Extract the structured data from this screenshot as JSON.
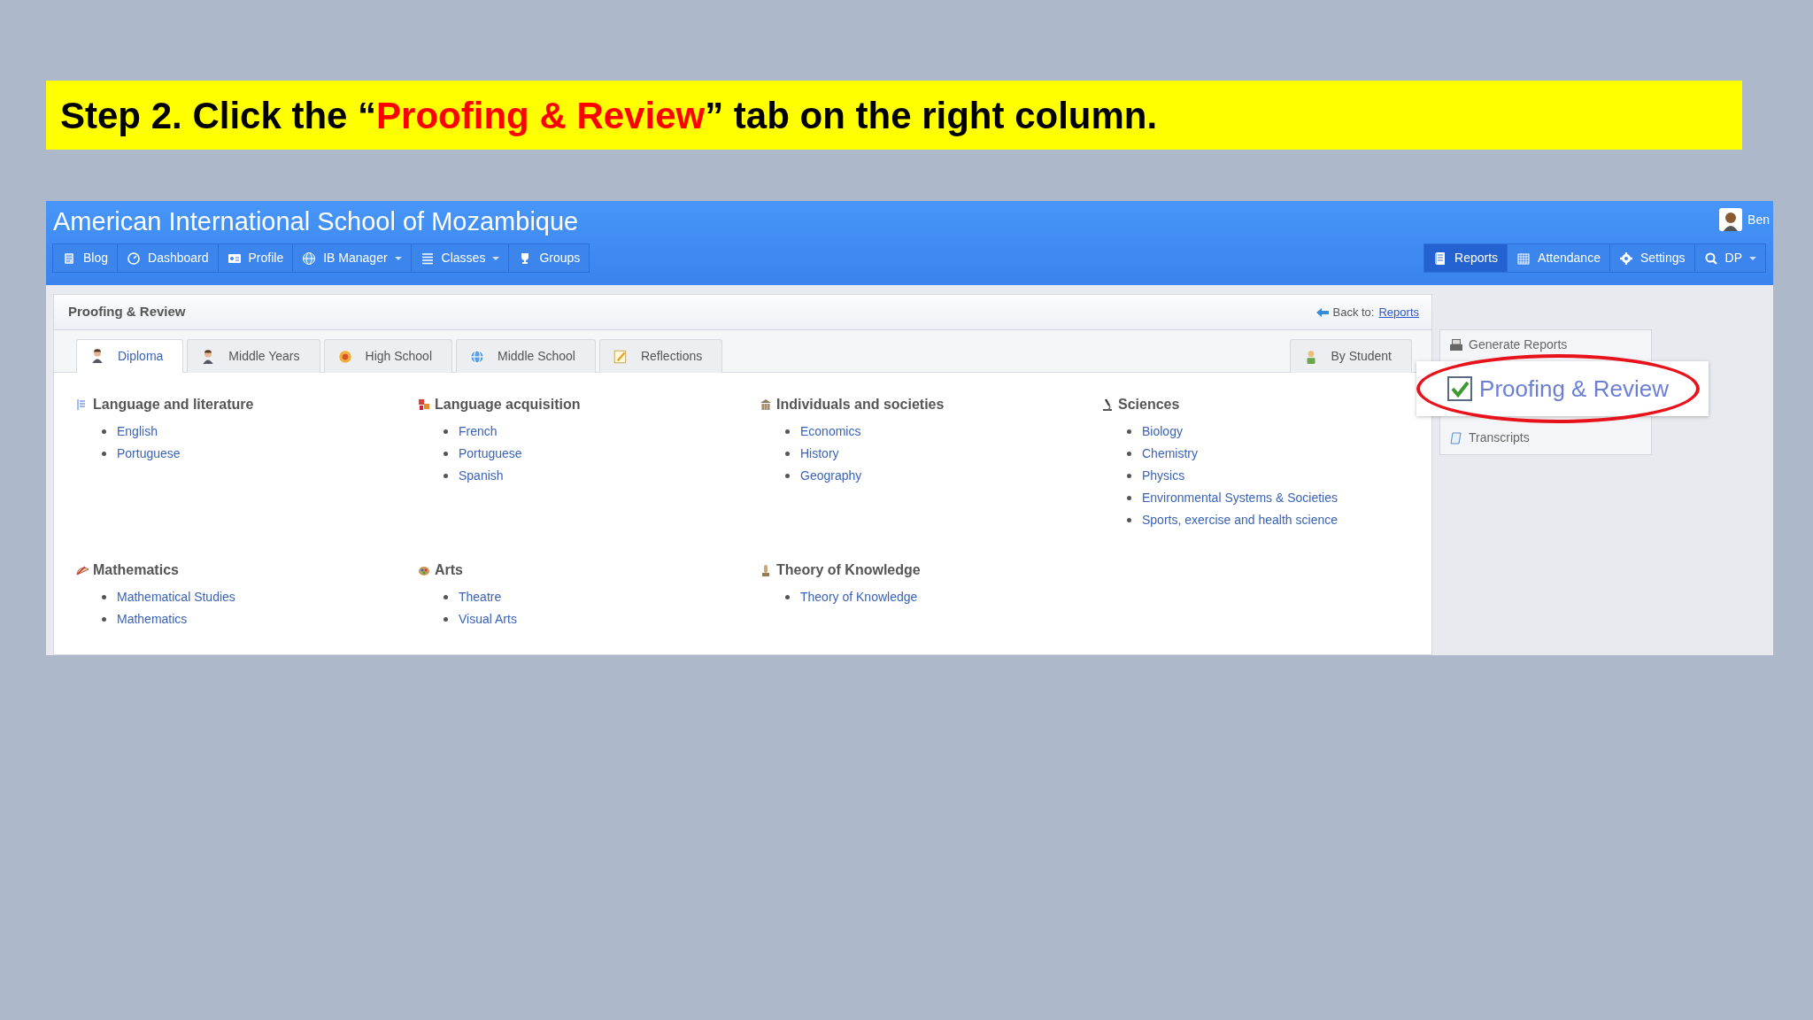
{
  "slide": {
    "instruction": {
      "before": "Step 2. Click the “",
      "highlight": "Proofing & Review",
      "after": "” tab on the right column."
    }
  },
  "app": {
    "school_name": "American International School of Mozambique",
    "user_name": "Ben",
    "nav_left": [
      {
        "label": "Blog",
        "dropdown": false
      },
      {
        "label": "Dashboard",
        "dropdown": false
      },
      {
        "label": "Profile",
        "dropdown": false
      },
      {
        "label": "IB Manager",
        "dropdown": true
      },
      {
        "label": "Classes",
        "dropdown": true
      },
      {
        "label": "Groups",
        "dropdown": false
      }
    ],
    "nav_right": [
      {
        "label": "Reports",
        "selected": true,
        "dropdown": false
      },
      {
        "label": "Attendance",
        "selected": false,
        "dropdown": false
      },
      {
        "label": "Settings",
        "selected": false,
        "dropdown": false
      },
      {
        "label": "DP",
        "selected": false,
        "dropdown": true
      }
    ],
    "panel": {
      "title": "Proofing & Review",
      "back_label": "Back to:",
      "back_link": "Reports",
      "tabs": [
        {
          "label": "Diploma",
          "selected": true
        },
        {
          "label": "Middle Years",
          "selected": false
        },
        {
          "label": "High School",
          "selected": false
        },
        {
          "label": "Middle School",
          "selected": false
        },
        {
          "label": "Reflections",
          "selected": false
        }
      ],
      "by_student": {
        "label": "By Student",
        "selected": false
      },
      "groups": [
        {
          "title": "Language and literature",
          "items": [
            "English",
            "Portuguese"
          ]
        },
        {
          "title": "Language acquisition",
          "items": [
            "French",
            "Portuguese",
            "Spanish"
          ]
        },
        {
          "title": "Individuals and societies",
          "items": [
            "Economics",
            "History",
            "Geography"
          ]
        },
        {
          "title": "Sciences",
          "items": [
            "Biology",
            "Chemistry",
            "Physics",
            "Environmental Systems & Societies",
            "Sports, exercise and health science"
          ]
        },
        {
          "title": "Mathematics",
          "items": [
            "Mathematical Studies",
            "Mathematics"
          ]
        },
        {
          "title": "Arts",
          "items": [
            "Theatre",
            "Visual Arts"
          ]
        },
        {
          "title": "Theory of Knowledge",
          "items": [
            "Theory of Knowledge"
          ]
        }
      ]
    },
    "side_menu": [
      "Generate Reports",
      "Transcripts"
    ],
    "callout": {
      "label": "Proofing & Review",
      "checked": true
    }
  }
}
